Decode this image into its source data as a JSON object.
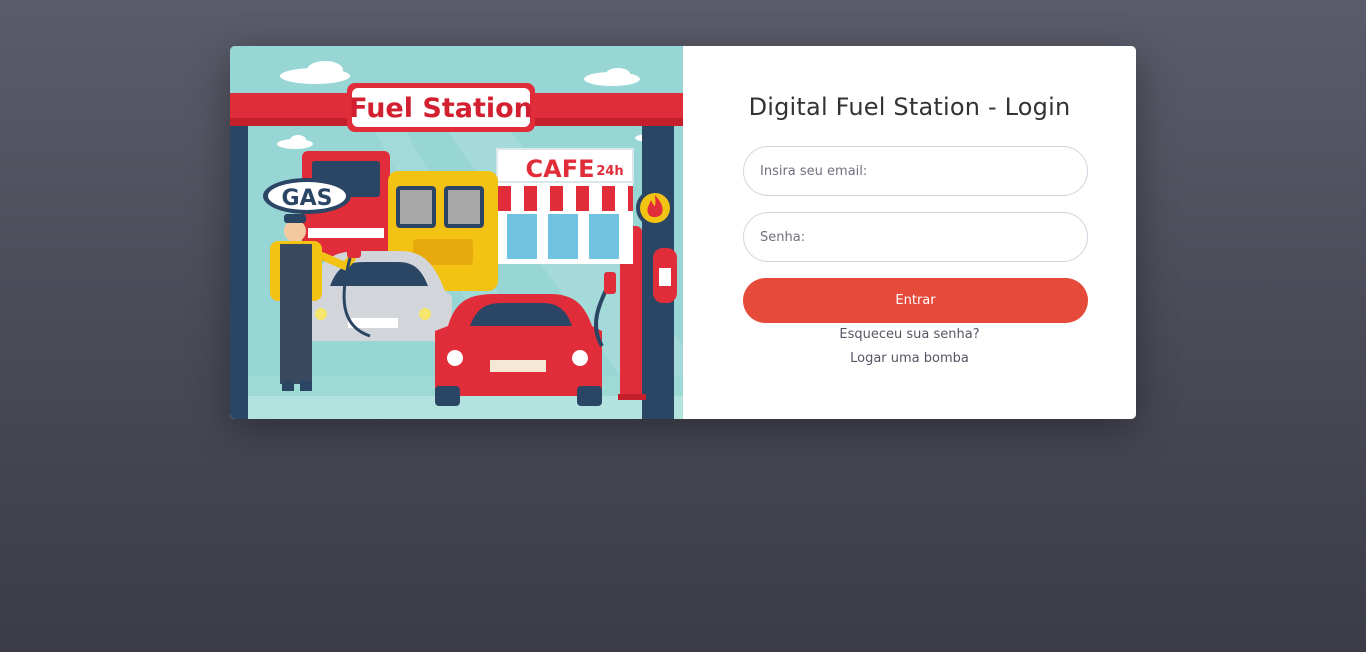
{
  "illustration": {
    "sign_text": "Fuel Station",
    "gas_text": "GAS",
    "cafe_text": "CAFE",
    "cafe_hours": "24h",
    "flame_icon": "flame-icon"
  },
  "login": {
    "title": "Digital Fuel Station - Login",
    "email_placeholder": "Insira seu email:",
    "password_placeholder": "Senha:",
    "submit_label": "Entrar",
    "forgot_link": "Esqueceu sua senha?",
    "pump_link": "Logar uma bomba"
  },
  "colors": {
    "accent": "#e54a3a",
    "background_top": "#5b5c6a",
    "background_bottom": "#3b3c47",
    "card": "#ffffff"
  }
}
